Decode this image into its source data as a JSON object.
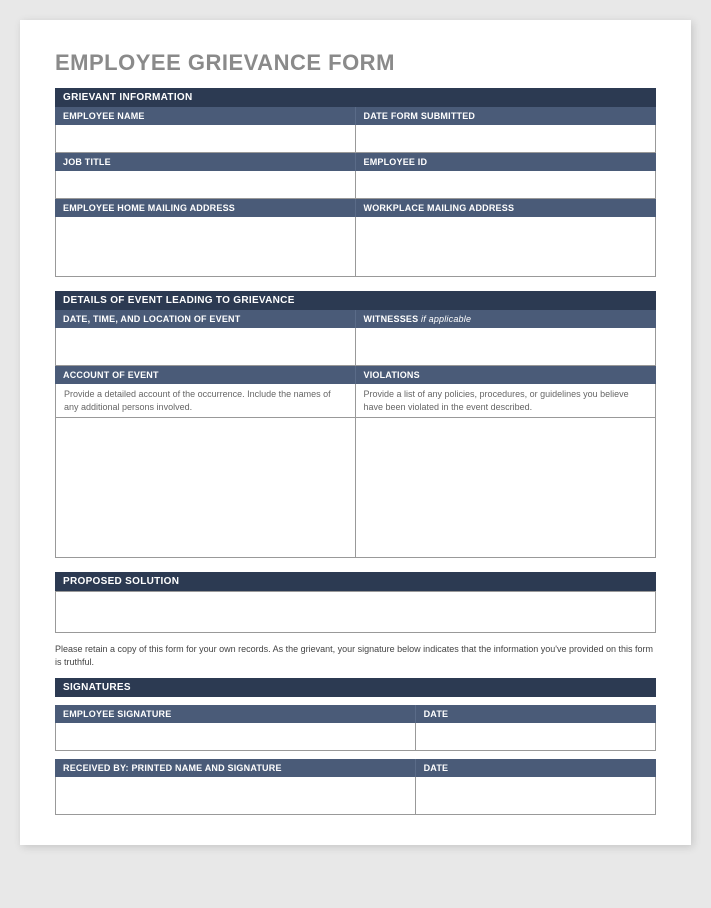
{
  "title": "EMPLOYEE GRIEVANCE FORM",
  "sections": {
    "grievant": {
      "header": "GRIEVANT INFORMATION",
      "employee_name": "EMPLOYEE NAME",
      "date_submitted": "DATE FORM SUBMITTED",
      "job_title": "JOB TITLE",
      "employee_id": "EMPLOYEE ID",
      "home_address": "EMPLOYEE HOME MAILING ADDRESS",
      "workplace_address": "WORKPLACE MAILING ADDRESS"
    },
    "details": {
      "header": "DETAILS OF EVENT LEADING TO GRIEVANCE",
      "date_time_location": "DATE, TIME, AND LOCATION OF EVENT",
      "witnesses_label": "WITNESSES",
      "witnesses_suffix": " if applicable",
      "account_label": "ACCOUNT OF EVENT",
      "violations_label": "VIOLATIONS",
      "account_hint": "Provide a detailed account of the occurrence. Include the names of any additional persons involved.",
      "violations_hint": "Provide a list of any policies, procedures, or guidelines you believe have been violated in the event described."
    },
    "solution": {
      "header": "PROPOSED SOLUTION"
    },
    "disclaimer": "Please retain a copy of this form for your own records.  As the grievant, your signature below indicates that the information you've provided on this form is truthful.",
    "signatures": {
      "header": "SIGNATURES",
      "employee_signature": "EMPLOYEE SIGNATURE",
      "date1": "DATE",
      "received_by": "RECEIVED BY: PRINTED NAME AND SIGNATURE",
      "date2": "DATE"
    }
  }
}
